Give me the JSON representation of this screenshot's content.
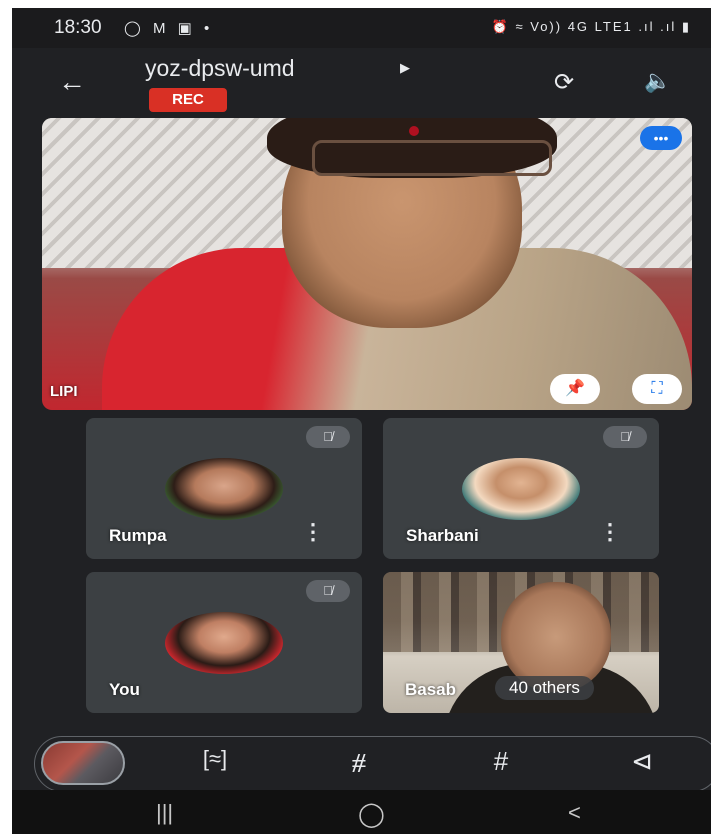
{
  "status_bar": {
    "time": "18:30",
    "left_icons": [
      "whatsapp-icon",
      "gmail-icon",
      "gallery-icon",
      "dot"
    ],
    "right_text": "Vo)) 4G LTE1 .ıl .ıl"
  },
  "header": {
    "meeting_code": "yoz-dpsw-umd",
    "recording_badge": "REC"
  },
  "main_tile": {
    "name": "LIPI"
  },
  "participants": [
    {
      "name": "Rumpa",
      "muted": true
    },
    {
      "name": "Sharbani",
      "muted": true
    },
    {
      "name": "You",
      "muted": true
    },
    {
      "name": "Basab",
      "muted": false
    }
  ],
  "others_count": "40 others",
  "controls": [
    "self-view",
    "select-icon",
    "effects-icon",
    "hashtag-icon",
    "share-icon"
  ],
  "colors": {
    "background": "#202124",
    "tile": "#3c4043",
    "rec": "#d93025",
    "accent": "#1a73e8"
  }
}
